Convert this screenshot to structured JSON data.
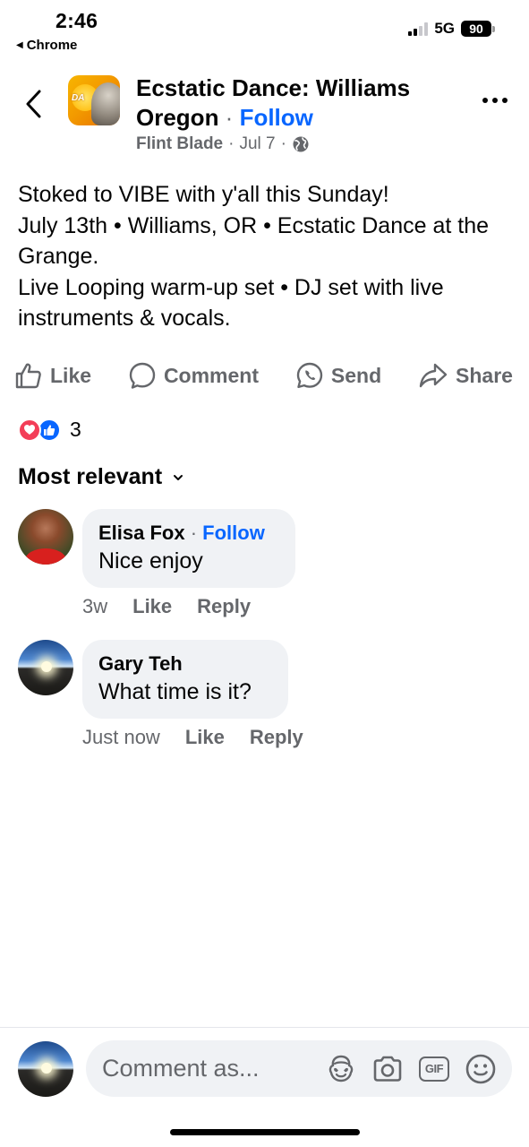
{
  "status_bar": {
    "time": "2:46",
    "back_app": "Chrome",
    "network": "5G",
    "battery": "90"
  },
  "header": {
    "page_name": "Ecstatic Dance: Williams Oregon",
    "follow_label": "Follow",
    "author": "Flint Blade",
    "date": "Jul 7",
    "avatar_label": "DA"
  },
  "post": {
    "lines": [
      "Stoked to VIBE with y'all this Sunday!",
      "July 13th • Williams, OR • Ecstatic Dance at the Grange.",
      "Live Looping warm-up set • DJ set with live instruments & vocals."
    ]
  },
  "actions": {
    "like": "Like",
    "comment": "Comment",
    "send": "Send",
    "share": "Share"
  },
  "reactions": {
    "count": "3"
  },
  "sort": {
    "label": "Most relevant"
  },
  "comments": [
    {
      "name": "Elisa Fox",
      "follow": "Follow",
      "text": "Nice enjoy",
      "time": "3w",
      "like": "Like",
      "reply": "Reply"
    },
    {
      "name": "Gary Teh",
      "text": "What time is it?",
      "time": "Just now",
      "like": "Like",
      "reply": "Reply"
    }
  ],
  "composer": {
    "placeholder": "Comment as...",
    "gif_label": "GIF"
  },
  "colors": {
    "accent": "#0866ff",
    "secondary_text": "#65676b",
    "bubble_bg": "#f0f2f5",
    "love": "#f33e58"
  }
}
